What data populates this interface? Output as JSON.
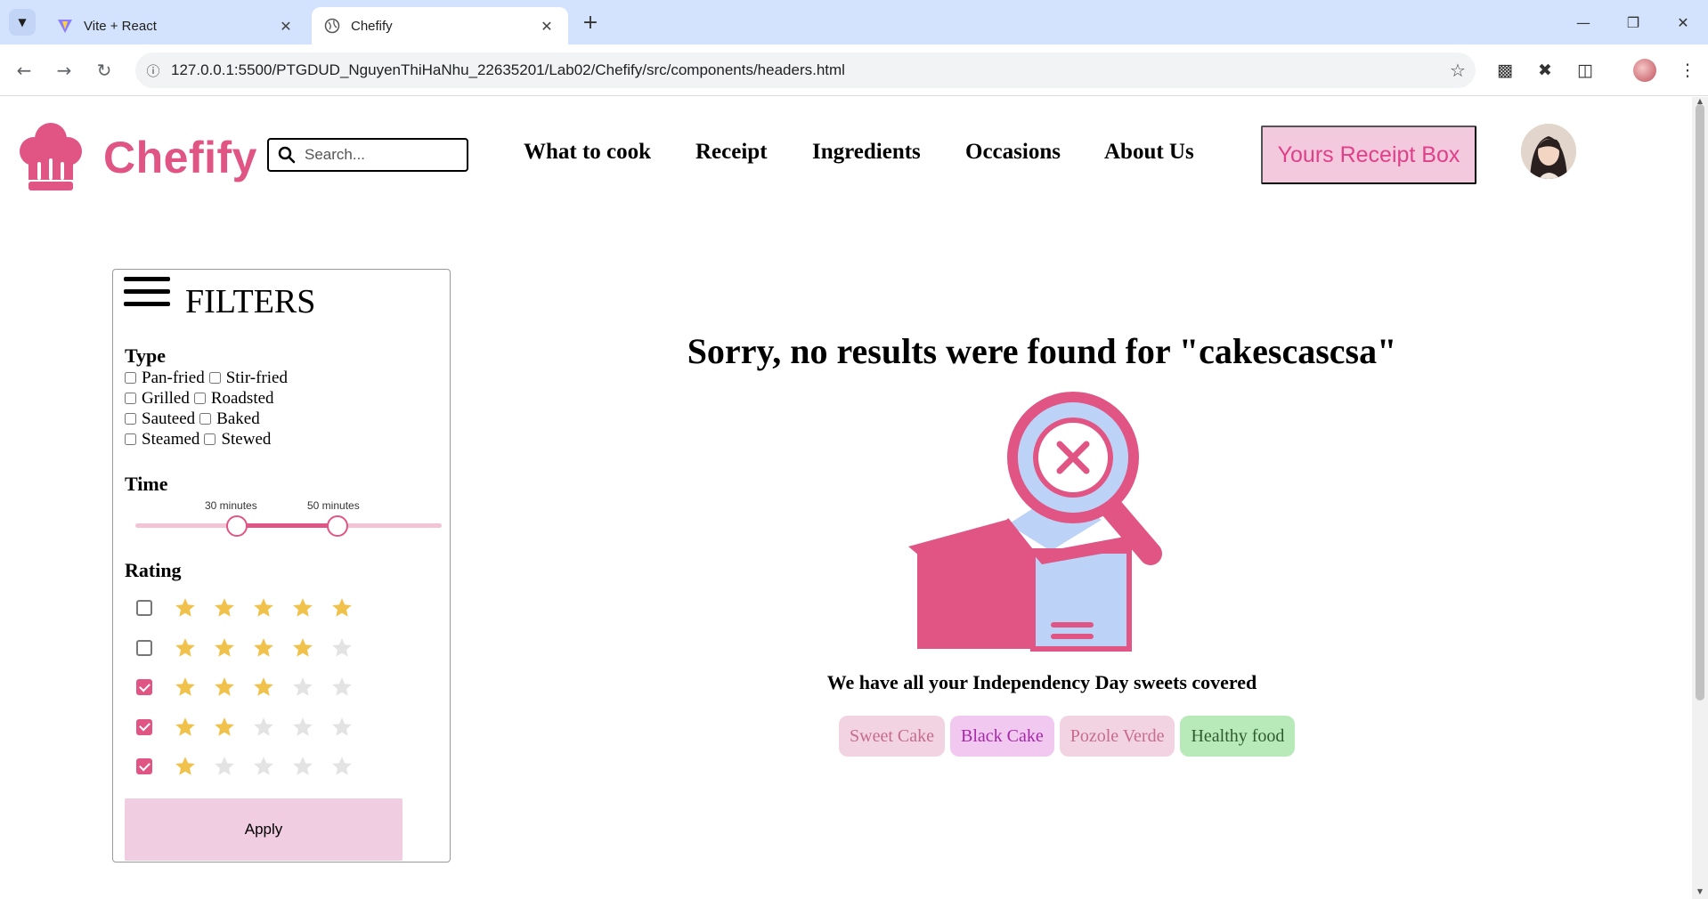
{
  "browser": {
    "tabs": [
      {
        "title": "Vite + React",
        "active": false,
        "icon": "vite-icon"
      },
      {
        "title": "Chefify",
        "active": true,
        "icon": "globe-icon"
      }
    ],
    "url": "127.0.0.1:5500/PTGDUD_NguyenThiHaNhu_22635201/Lab02/Chefify/src/components/headers.html"
  },
  "header": {
    "brand": "Chefify",
    "search_placeholder": "Search...",
    "nav": [
      "What to cook",
      "Receipt",
      "Ingredients",
      "Occasions",
      "About Us"
    ],
    "cta": "Yours Receipt Box"
  },
  "filters": {
    "title": "FILTERS",
    "type_title": "Type",
    "types": [
      [
        "Pan-fried",
        "Stir-fried"
      ],
      [
        "Grilled",
        "Roadsted"
      ],
      [
        "Sauteed",
        "Baked"
      ],
      [
        "Steamed",
        "Stewed"
      ]
    ],
    "time_title": "Time",
    "time_min_label": "30 minutes",
    "time_max_label": "50 minutes",
    "time_range_fraction": [
      0.33,
      0.66
    ],
    "rating_title": "Rating",
    "ratings": [
      {
        "stars": 5,
        "checked": false
      },
      {
        "stars": 4,
        "checked": false
      },
      {
        "stars": 3,
        "checked": true
      },
      {
        "stars": 2,
        "checked": true
      },
      {
        "stars": 1,
        "checked": true
      }
    ],
    "apply_label": "Apply"
  },
  "results": {
    "message": "Sorry, no results were found for \"cakescascsa\"",
    "subtitle": "We have all your Independency Day sweets covered",
    "chips": [
      {
        "label": "Sweet Cake",
        "bg": "#f2d3e1",
        "color": "#c76b8f"
      },
      {
        "label": "Black Cake",
        "bg": "#f0c8f0",
        "color": "#a628a8"
      },
      {
        "label": "Pozole Verde",
        "bg": "#f2d3e1",
        "color": "#c76b8f"
      },
      {
        "label": "Healthy food",
        "bg": "#b8eab9",
        "color": "#2f5a30"
      }
    ]
  },
  "colors": {
    "accent": "#e05584",
    "star_filled": "#f1c24b",
    "star_empty": "#e3e3e3"
  }
}
